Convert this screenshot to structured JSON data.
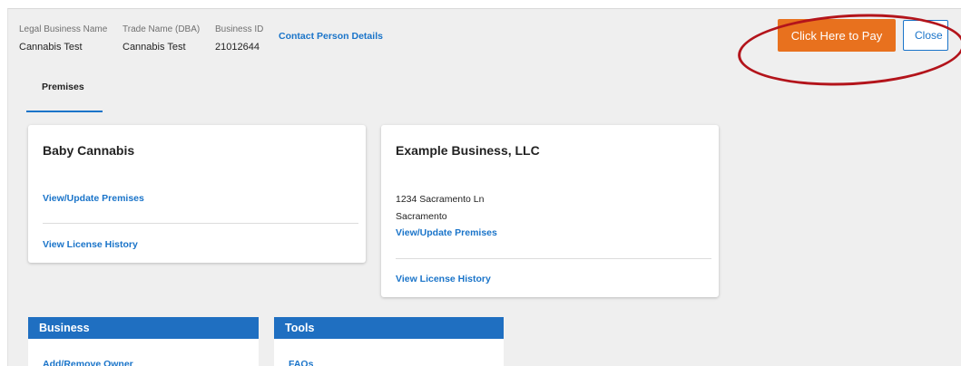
{
  "header": {
    "legal_name_label": "Legal Business Name",
    "legal_name_value": "Cannabis Test",
    "dba_label": "Trade Name (DBA)",
    "dba_value": "Cannabis Test",
    "business_id_label": "Business ID",
    "business_id_value": "21012644",
    "contact_link": "Contact Person Details",
    "pay_button": "Click Here to Pay",
    "close_button": "Close"
  },
  "tabs": [
    {
      "label": "Premises",
      "active": true
    }
  ],
  "cards": [
    {
      "title": "Baby Cannabis",
      "view_update": "View/Update Premises",
      "license_history": "View License History"
    },
    {
      "title": "Example Business, LLC",
      "address_line1": "1234 Sacramento Ln",
      "address_line2": "Sacramento",
      "view_update": "View/Update Premises",
      "license_history": "View License History"
    }
  ],
  "panels": [
    {
      "title": "Business",
      "first_link": "Add/Remove Owner"
    },
    {
      "title": "Tools",
      "first_link": "FAQs"
    }
  ],
  "colors": {
    "accent_blue": "#1a74c9",
    "pay_orange": "#e8711e",
    "annotation_red": "#b3141b",
    "panel_header_blue": "#1f6fc1"
  }
}
